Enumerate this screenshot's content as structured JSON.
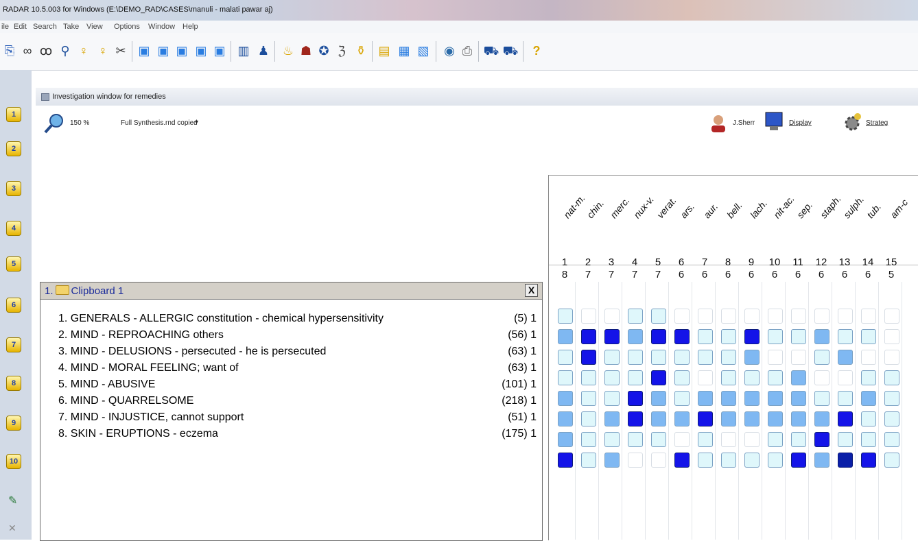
{
  "window": {
    "title": "RADAR 10.5.003 for Windows  (E:\\DEMO_RAD\\CASES\\manuli - malati pawar aj)"
  },
  "menu": [
    "ile",
    "Edit",
    "Search",
    "Take",
    "View",
    "Options",
    "Window",
    "Help"
  ],
  "toolbar_icons": [
    "new-case-icon",
    "binoculars-icon",
    "glasses-icon",
    "magnifier-icon",
    "lightbulb-icon",
    "question-bulb-icon",
    "scissors-icon",
    "clipboard-1-icon",
    "clipboard-2-icon",
    "clipboard-3-icon",
    "clipboard-4-icon",
    "clipboard-5-icon",
    "chart-icon",
    "family-icon",
    "candle-icon",
    "hat-icon",
    "circle-icon",
    "counter-icon",
    "bottle-icon",
    "book-icon",
    "window-icon",
    "note-icon",
    "globe-icon",
    "printer-icon",
    "cars-icon",
    "cars-2-icon",
    "help-icon"
  ],
  "sidebar": [
    "1",
    "2",
    "3",
    "4",
    "5",
    "6",
    "7",
    "8",
    "9",
    "10"
  ],
  "investigation": {
    "title": "Investigation window for remedies",
    "zoom": "150 %",
    "synthesis": "Full Synthesis.rnd copied",
    "user": "J.Sherr",
    "display": "Display",
    "strategy": "Strateg"
  },
  "clipboard": {
    "title": "Clipboard 1",
    "index": "1.",
    "close": "X",
    "rubrics": [
      {
        "text": "1. GENERALS - ALLERGIC constitution - chemical hypersensitivity",
        "count": "(5) 1"
      },
      {
        "text": "2. MIND - REPROACHING others",
        "count": "(56) 1"
      },
      {
        "text": "3. MIND - DELUSIONS - persecuted - he is persecuted",
        "count": "(63) 1"
      },
      {
        "text": "4. MIND - MORAL FEELING; want of",
        "count": "(63) 1"
      },
      {
        "text": "5. MIND - ABUSIVE",
        "count": "(101) 1"
      },
      {
        "text": "6. MIND - QUARRELSOME",
        "count": "(218) 1"
      },
      {
        "text": "7. MIND - INJUSTICE, cannot support",
        "count": "(51) 1"
      },
      {
        "text": "8. SKIN - ERUPTIONS - eczema",
        "count": "(175) 1"
      }
    ]
  },
  "remedies": [
    {
      "name": "nat-m.",
      "num": "1",
      "score": "8"
    },
    {
      "name": "chin.",
      "num": "2",
      "score": "7"
    },
    {
      "name": "merc.",
      "num": "3",
      "score": "7"
    },
    {
      "name": "nux-v.",
      "num": "4",
      "score": "7"
    },
    {
      "name": "verat.",
      "num": "5",
      "score": "7"
    },
    {
      "name": "ars.",
      "num": "6",
      "score": "6"
    },
    {
      "name": "aur.",
      "num": "7",
      "score": "6"
    },
    {
      "name": "bell.",
      "num": "8",
      "score": "6"
    },
    {
      "name": "lach.",
      "num": "9",
      "score": "6"
    },
    {
      "name": "nit-ac.",
      "num": "10",
      "score": "6"
    },
    {
      "name": "sep.",
      "num": "11",
      "score": "6"
    },
    {
      "name": "staph.",
      "num": "12",
      "score": "6"
    },
    {
      "name": "sulph.",
      "num": "13",
      "score": "6"
    },
    {
      "name": "tub.",
      "num": "14",
      "score": "6"
    },
    {
      "name": "am-c",
      "num": "15",
      "score": "5"
    }
  ],
  "grades": [
    [
      1,
      0,
      0,
      1,
      1,
      0,
      0,
      0,
      0,
      0,
      0,
      0,
      0,
      0,
      0
    ],
    [
      2,
      3,
      3,
      2,
      3,
      3,
      1,
      1,
      3,
      1,
      1,
      2,
      1,
      1,
      0
    ],
    [
      1,
      3,
      1,
      1,
      1,
      1,
      1,
      1,
      2,
      0,
      0,
      1,
      2,
      0,
      0
    ],
    [
      1,
      1,
      1,
      1,
      3,
      1,
      0,
      1,
      1,
      1,
      2,
      0,
      0,
      1,
      1
    ],
    [
      2,
      1,
      1,
      3,
      2,
      1,
      2,
      2,
      2,
      2,
      2,
      1,
      1,
      2,
      1
    ],
    [
      2,
      1,
      2,
      3,
      2,
      2,
      3,
      2,
      2,
      2,
      2,
      2,
      3,
      1,
      1
    ],
    [
      2,
      1,
      1,
      1,
      1,
      0,
      1,
      0,
      0,
      1,
      1,
      3,
      1,
      1,
      1
    ],
    [
      3,
      1,
      2,
      0,
      0,
      3,
      1,
      1,
      1,
      1,
      3,
      2,
      4,
      3,
      1
    ]
  ],
  "grade_colors": {
    "0": "#ffffff",
    "1": "#dff7fb",
    "2": "#7fb8f2",
    "3": "#1414e8",
    "4": "#0a1fa8"
  }
}
